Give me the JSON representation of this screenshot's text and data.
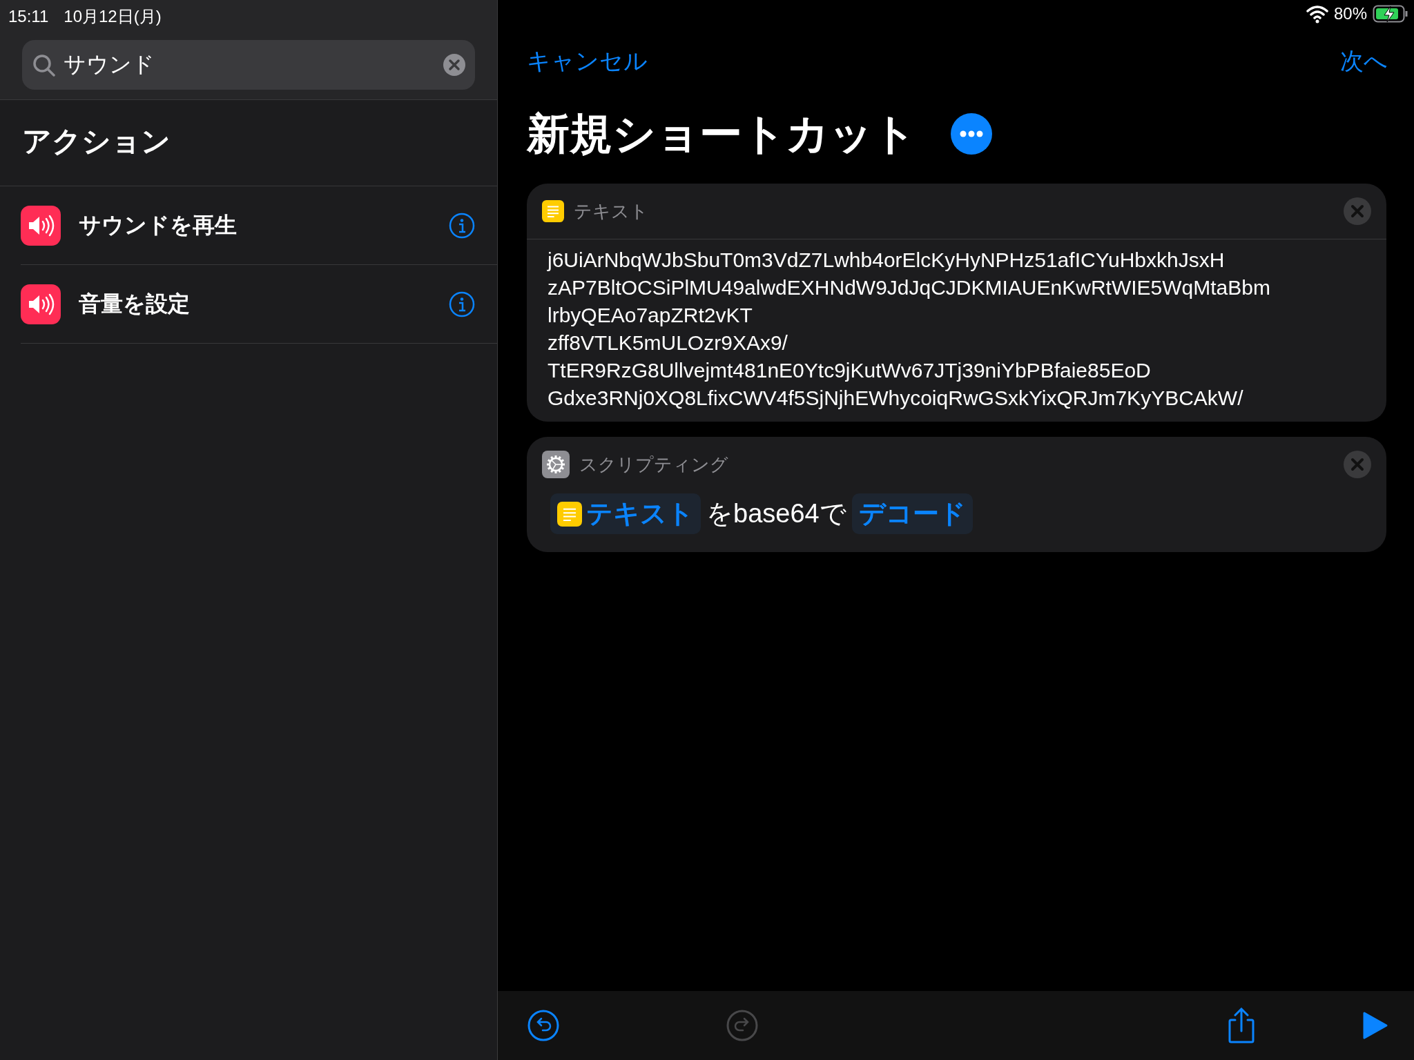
{
  "status_bar": {
    "time": "15:11",
    "date": "10月12日(月)",
    "battery": "80%"
  },
  "search": {
    "value": "サウンド"
  },
  "sidebar": {
    "heading": "アクション",
    "items": [
      {
        "label": "サウンドを再生"
      },
      {
        "label": "音量を設定"
      }
    ]
  },
  "nav": {
    "cancel": "キャンセル",
    "next": "次へ"
  },
  "title": "新規ショートカット",
  "actions": [
    {
      "kind": "text",
      "category": "テキスト",
      "lines": [
        "j6UiArNbqWJbSbuT0m3VdZ7Lwhb4orElcKyHyNPHz51afICYuHbxkhJsxH",
        "zAP7BltOCSiPlMU49alwdEXHNdW9JdJqCJDKMIAUEnKwRtWIE5WqMtaBbm",
        "lrbyQEAo7apZRt2vKT",
        "zff8VTLK5mULOzr9XAx9/",
        "TtER9RzG8Ullvejmt481nE0Ytc9jKutWv67JTj39niYbPBfaie85EoD",
        "Gdxe3RNj0XQ8LfixCWV4f5SjNjhEWhycoiqRwGSxkYixQRJm7KyYBCAkW/"
      ]
    },
    {
      "kind": "script",
      "category": "スクリプティング",
      "variable": "テキスト",
      "middle": "をbase64で",
      "mode": "デコード"
    }
  ],
  "toolbar": [
    {
      "kind": "undo",
      "disabled": false
    },
    {
      "kind": "redo",
      "disabled": true
    },
    {
      "kind": "share",
      "disabled": false
    },
    {
      "kind": "run",
      "disabled": false
    }
  ]
}
